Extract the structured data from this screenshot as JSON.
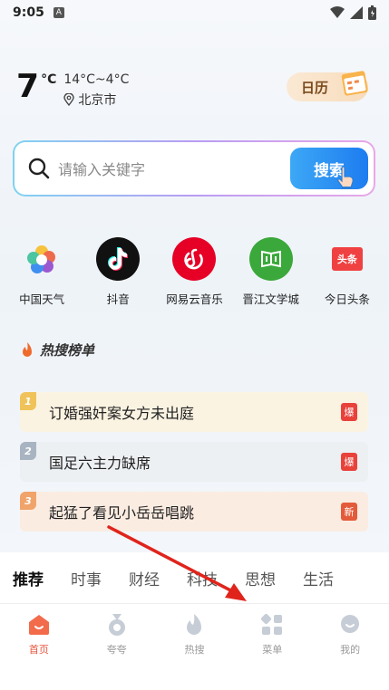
{
  "status": {
    "time": "9:05",
    "a_icon": "A"
  },
  "weather": {
    "temp": "7",
    "unit": "°C",
    "range": "14°C~4°C",
    "city": "北京市"
  },
  "calendar": {
    "label": "日历"
  },
  "search": {
    "placeholder": "请输入关键字",
    "button": "搜索"
  },
  "apps": [
    {
      "label": "中国天气",
      "icon": "china-weather-icon"
    },
    {
      "label": "抖音",
      "icon": "douyin-icon"
    },
    {
      "label": "网易云音乐",
      "icon": "netease-music-icon"
    },
    {
      "label": "晋江文学城",
      "icon": "jjwxc-icon"
    },
    {
      "label": "今日头条",
      "icon": "toutiao-icon",
      "icon_text": "头条"
    }
  ],
  "hot": {
    "title": "热搜榜单",
    "items": [
      {
        "rank": "1",
        "text": "订婚强奸案女方未出庭",
        "badge": "爆"
      },
      {
        "rank": "2",
        "text": "国足六主力缺席",
        "badge": "爆"
      },
      {
        "rank": "3",
        "text": "起猛了看见小岳岳唱跳",
        "badge": "新"
      }
    ]
  },
  "tabs": [
    "推荐",
    "时事",
    "财经",
    "科技",
    "思想",
    "生活"
  ],
  "nav": [
    {
      "label": "首页",
      "icon": "home-icon",
      "active": true
    },
    {
      "label": "夸夸",
      "icon": "medal-icon"
    },
    {
      "label": "热搜",
      "icon": "flame-icon"
    },
    {
      "label": "菜单",
      "icon": "grid-icon"
    },
    {
      "label": "我的",
      "icon": "profile-icon"
    }
  ],
  "colors": {
    "accent": "#1d7cf0",
    "nav_active": "#e8533b",
    "arrow": "#e0241c"
  }
}
